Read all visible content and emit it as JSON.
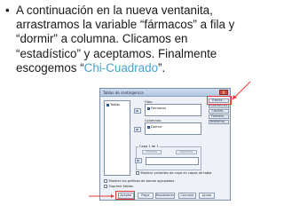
{
  "slide": {
    "bullet_symbol": "•",
    "lines": [
      "A continuación en la nueva ventanita,",
      "arrastramos la variable “fármacos” a fila y",
      "“dormir” a  columna. Clicamos en",
      "“estadístico” y aceptamos. Finalmente"
    ],
    "last_line_before": "escogemos “",
    "last_line_highlight": "Chi-Cuadrado",
    "last_line_after": "”."
  },
  "dialog": {
    "title": "Tablas de contingencia",
    "close_label": "X",
    "variables": [
      "Tablas"
    ],
    "filas_label": "Filas:",
    "filas_items": [
      "Fármacos"
    ],
    "columnas_label": "Columnas:",
    "columnas_items": [
      "Dormir"
    ],
    "capa_label": "Capa 1 de 1",
    "anterior_label": "Anterior",
    "siguiente_label": "Siguiente",
    "capa_check": "Mostrar variables de capa en capas de tabla",
    "options": [
      "Mostrar los gráficos de barras agrupadas",
      "Suprimir tablas"
    ],
    "side_buttons": [
      "Exacta...",
      "Estadísticos...",
      "Casillas...",
      "Formato...",
      "Bootstrap..."
    ],
    "bottom_buttons": [
      "Aceptar",
      "Pegar",
      "Restablecer",
      "Cancelar",
      "Ayuda"
    ],
    "arrow_symbol": "►"
  },
  "colors": {
    "highlight": "#4aa3c8",
    "annotation_red": "#e23a3a"
  }
}
